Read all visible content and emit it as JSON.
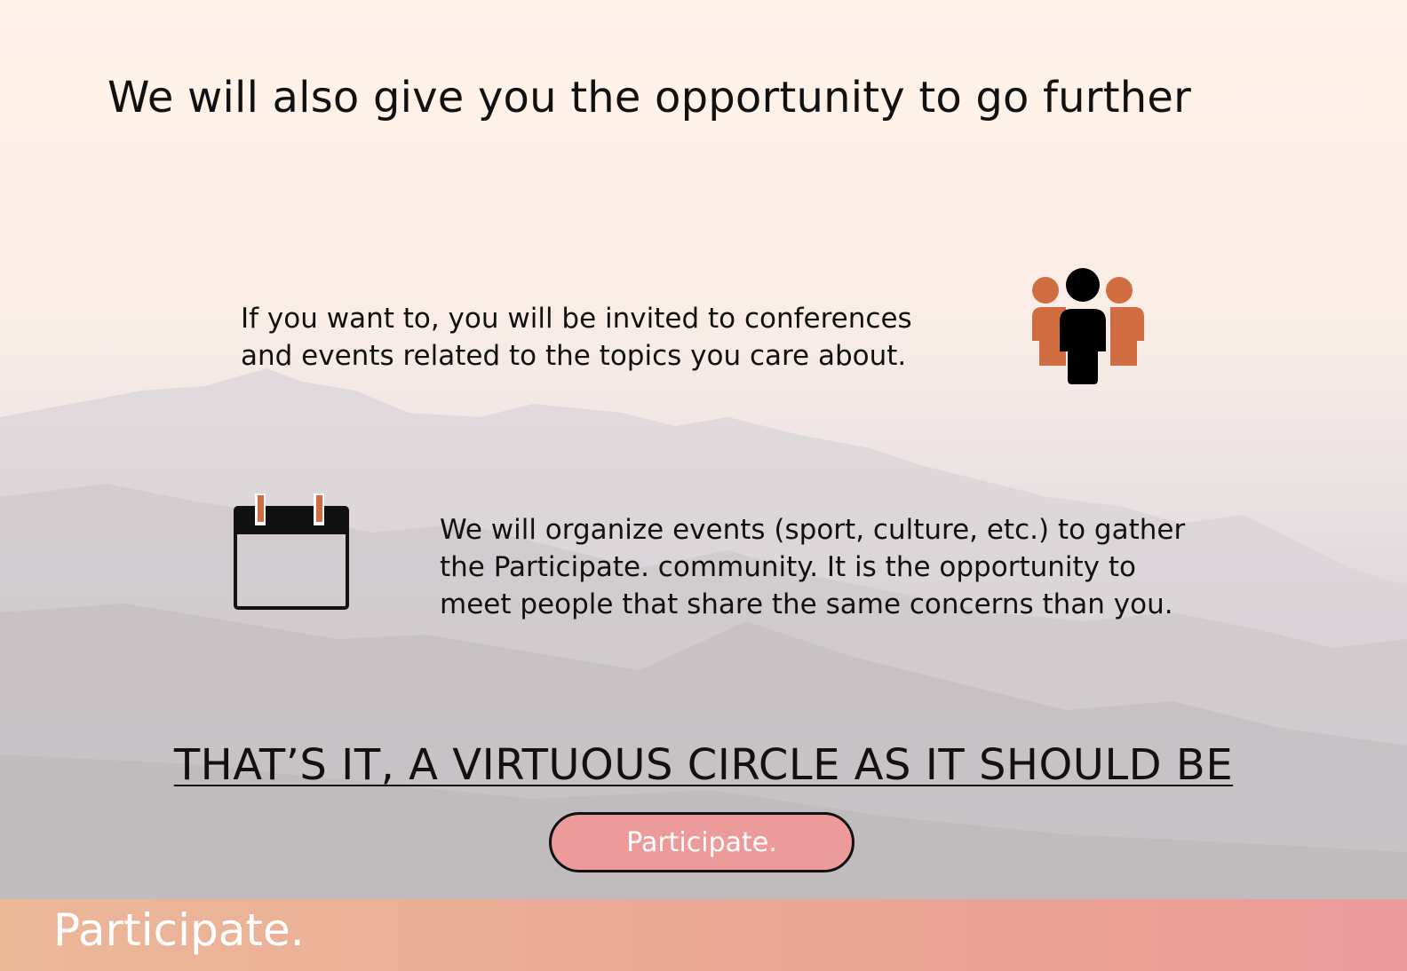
{
  "heading": "We will also give you the opportunity to go further",
  "features": [
    {
      "text": "If you want to, you will be invited to conferences\nand events related to the topics you care about.",
      "icon": "people-group-icon"
    },
    {
      "text": "We will organize events (sport, culture, etc.) to gather\nthe Participate. community. It is the opportunity to\nmeet people that share the same concerns than you.",
      "icon": "calendar-icon"
    }
  ],
  "tagline": "THAT’S IT, A VIRTUOUS CIRCLE AS IT SHOULD BE",
  "cta": {
    "label": "Participate."
  },
  "footer": {
    "brand": "Participate."
  },
  "colors": {
    "accent_orange": "#d06e42",
    "button_pink": "#ec9a9a",
    "footer_gradient_start": "#ebb898",
    "footer_gradient_end": "#ec9a9a"
  }
}
